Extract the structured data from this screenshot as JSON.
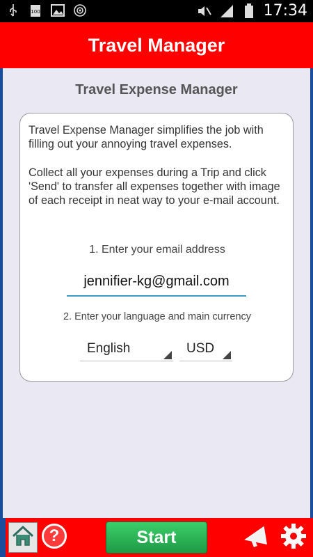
{
  "status_bar": {
    "time": "17:34",
    "left_icons": [
      "usb-icon",
      "battery-100-icon",
      "image-icon",
      "hotspot-icon"
    ],
    "right_icons": [
      "mute-icon",
      "signal-icon",
      "battery-icon"
    ]
  },
  "header": {
    "title": "Travel Manager"
  },
  "main": {
    "heading": "Travel Expense Manager",
    "description": "Travel Expense Manager simplifies the job with filling out your annoying travel expenses.\n\nCollect all your expenses during a Trip and click 'Send' to transfer all expenses together with image of each receipt in neat way to your e-mail account.",
    "step1_label": "1. Enter your email address",
    "email_value": "jennifier-kg@gmail.com",
    "step2_label": "2. Enter your language and main currency",
    "language_selected": "English",
    "currency_selected": "USD"
  },
  "bottom_bar": {
    "start_label": "Start",
    "help_label": "?",
    "icons": [
      "home-icon",
      "help-icon",
      "announce-icon",
      "settings-icon"
    ]
  },
  "colors": {
    "brand_red": "#ff0000",
    "start_green": "#2bb957",
    "frame_blue": "#1a4e9c",
    "content_bg": "#e9e8f3"
  }
}
